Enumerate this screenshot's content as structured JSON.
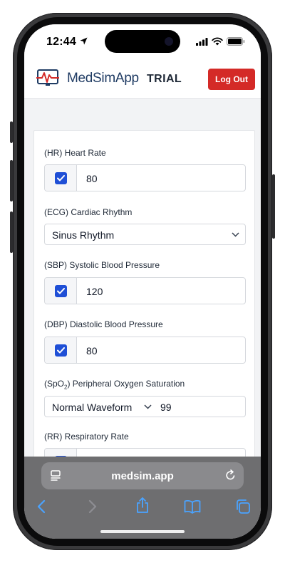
{
  "status": {
    "time": "12:44"
  },
  "header": {
    "brand": "MedSimApp",
    "mode": "TRIAL",
    "logout_label": "Log Out"
  },
  "form": {
    "hr": {
      "label": "(HR) Heart Rate",
      "checked": true,
      "value": "80"
    },
    "ecg": {
      "label": "(ECG) Cardiac Rhythm",
      "selected": "Sinus Rhythm"
    },
    "sbp": {
      "label": "(SBP) Systolic Blood Pressure",
      "checked": true,
      "value": "120"
    },
    "dbp": {
      "label": "(DBP) Diastolic Blood Pressure",
      "checked": true,
      "value": "80"
    },
    "spo2": {
      "label_prefix": "(SpO",
      "label_sub": "2",
      "label_suffix": ") Peripheral Oxygen Saturation",
      "waveform": "Normal Waveform",
      "value": "99"
    },
    "rr": {
      "label": "(RR) Respiratory Rate"
    }
  },
  "browser": {
    "url": "medsim.app"
  },
  "colors": {
    "accent": "#1f4fd6",
    "logout": "#d42a27",
    "brand": "#1f3b63"
  }
}
